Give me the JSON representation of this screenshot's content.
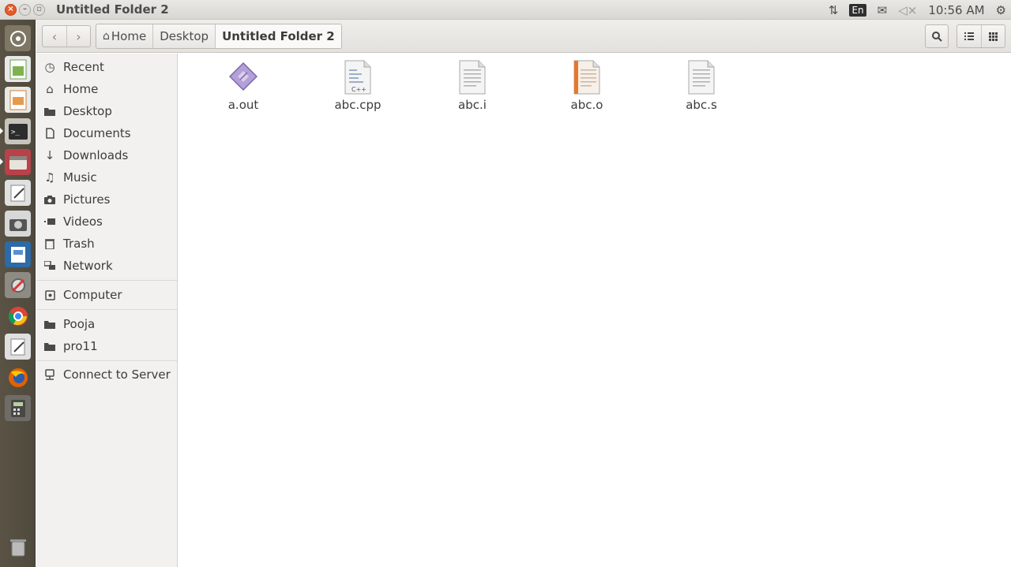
{
  "window": {
    "title": "Untitled Folder 2"
  },
  "panel": {
    "lang": "En",
    "time": "10:56 AM"
  },
  "breadcrumb": [
    "Home",
    "Desktop",
    "Untitled Folder 2"
  ],
  "sidebar": {
    "places": [
      {
        "label": "Recent",
        "icon": "clock-icon"
      },
      {
        "label": "Home",
        "icon": "home-icon"
      },
      {
        "label": "Desktop",
        "icon": "folder-icon"
      },
      {
        "label": "Documents",
        "icon": "document-icon"
      },
      {
        "label": "Downloads",
        "icon": "download-icon"
      },
      {
        "label": "Music",
        "icon": "music-icon"
      },
      {
        "label": "Pictures",
        "icon": "camera-icon"
      },
      {
        "label": "Videos",
        "icon": "video-icon"
      },
      {
        "label": "Trash",
        "icon": "trash-icon"
      },
      {
        "label": "Network",
        "icon": "network-icon"
      }
    ],
    "devices": [
      {
        "label": "Computer",
        "icon": "computer-icon"
      }
    ],
    "bookmarks": [
      {
        "label": "Pooja",
        "icon": "folder-icon"
      },
      {
        "label": "pro11",
        "icon": "folder-icon"
      }
    ],
    "other": [
      {
        "label": "Connect to Server",
        "icon": "server-icon"
      }
    ]
  },
  "files": [
    {
      "name": "a.out",
      "icon": "executable-icon"
    },
    {
      "name": "abc.cpp",
      "icon": "cpp-file-icon"
    },
    {
      "name": "abc.i",
      "icon": "text-file-icon"
    },
    {
      "name": "abc.o",
      "icon": "object-file-icon"
    },
    {
      "name": "abc.s",
      "icon": "text-file-icon"
    }
  ],
  "colors": {
    "accent": "#e65a2a",
    "launcher_bg": "#5a5345",
    "sidebar_bg": "#f2f1f0"
  }
}
